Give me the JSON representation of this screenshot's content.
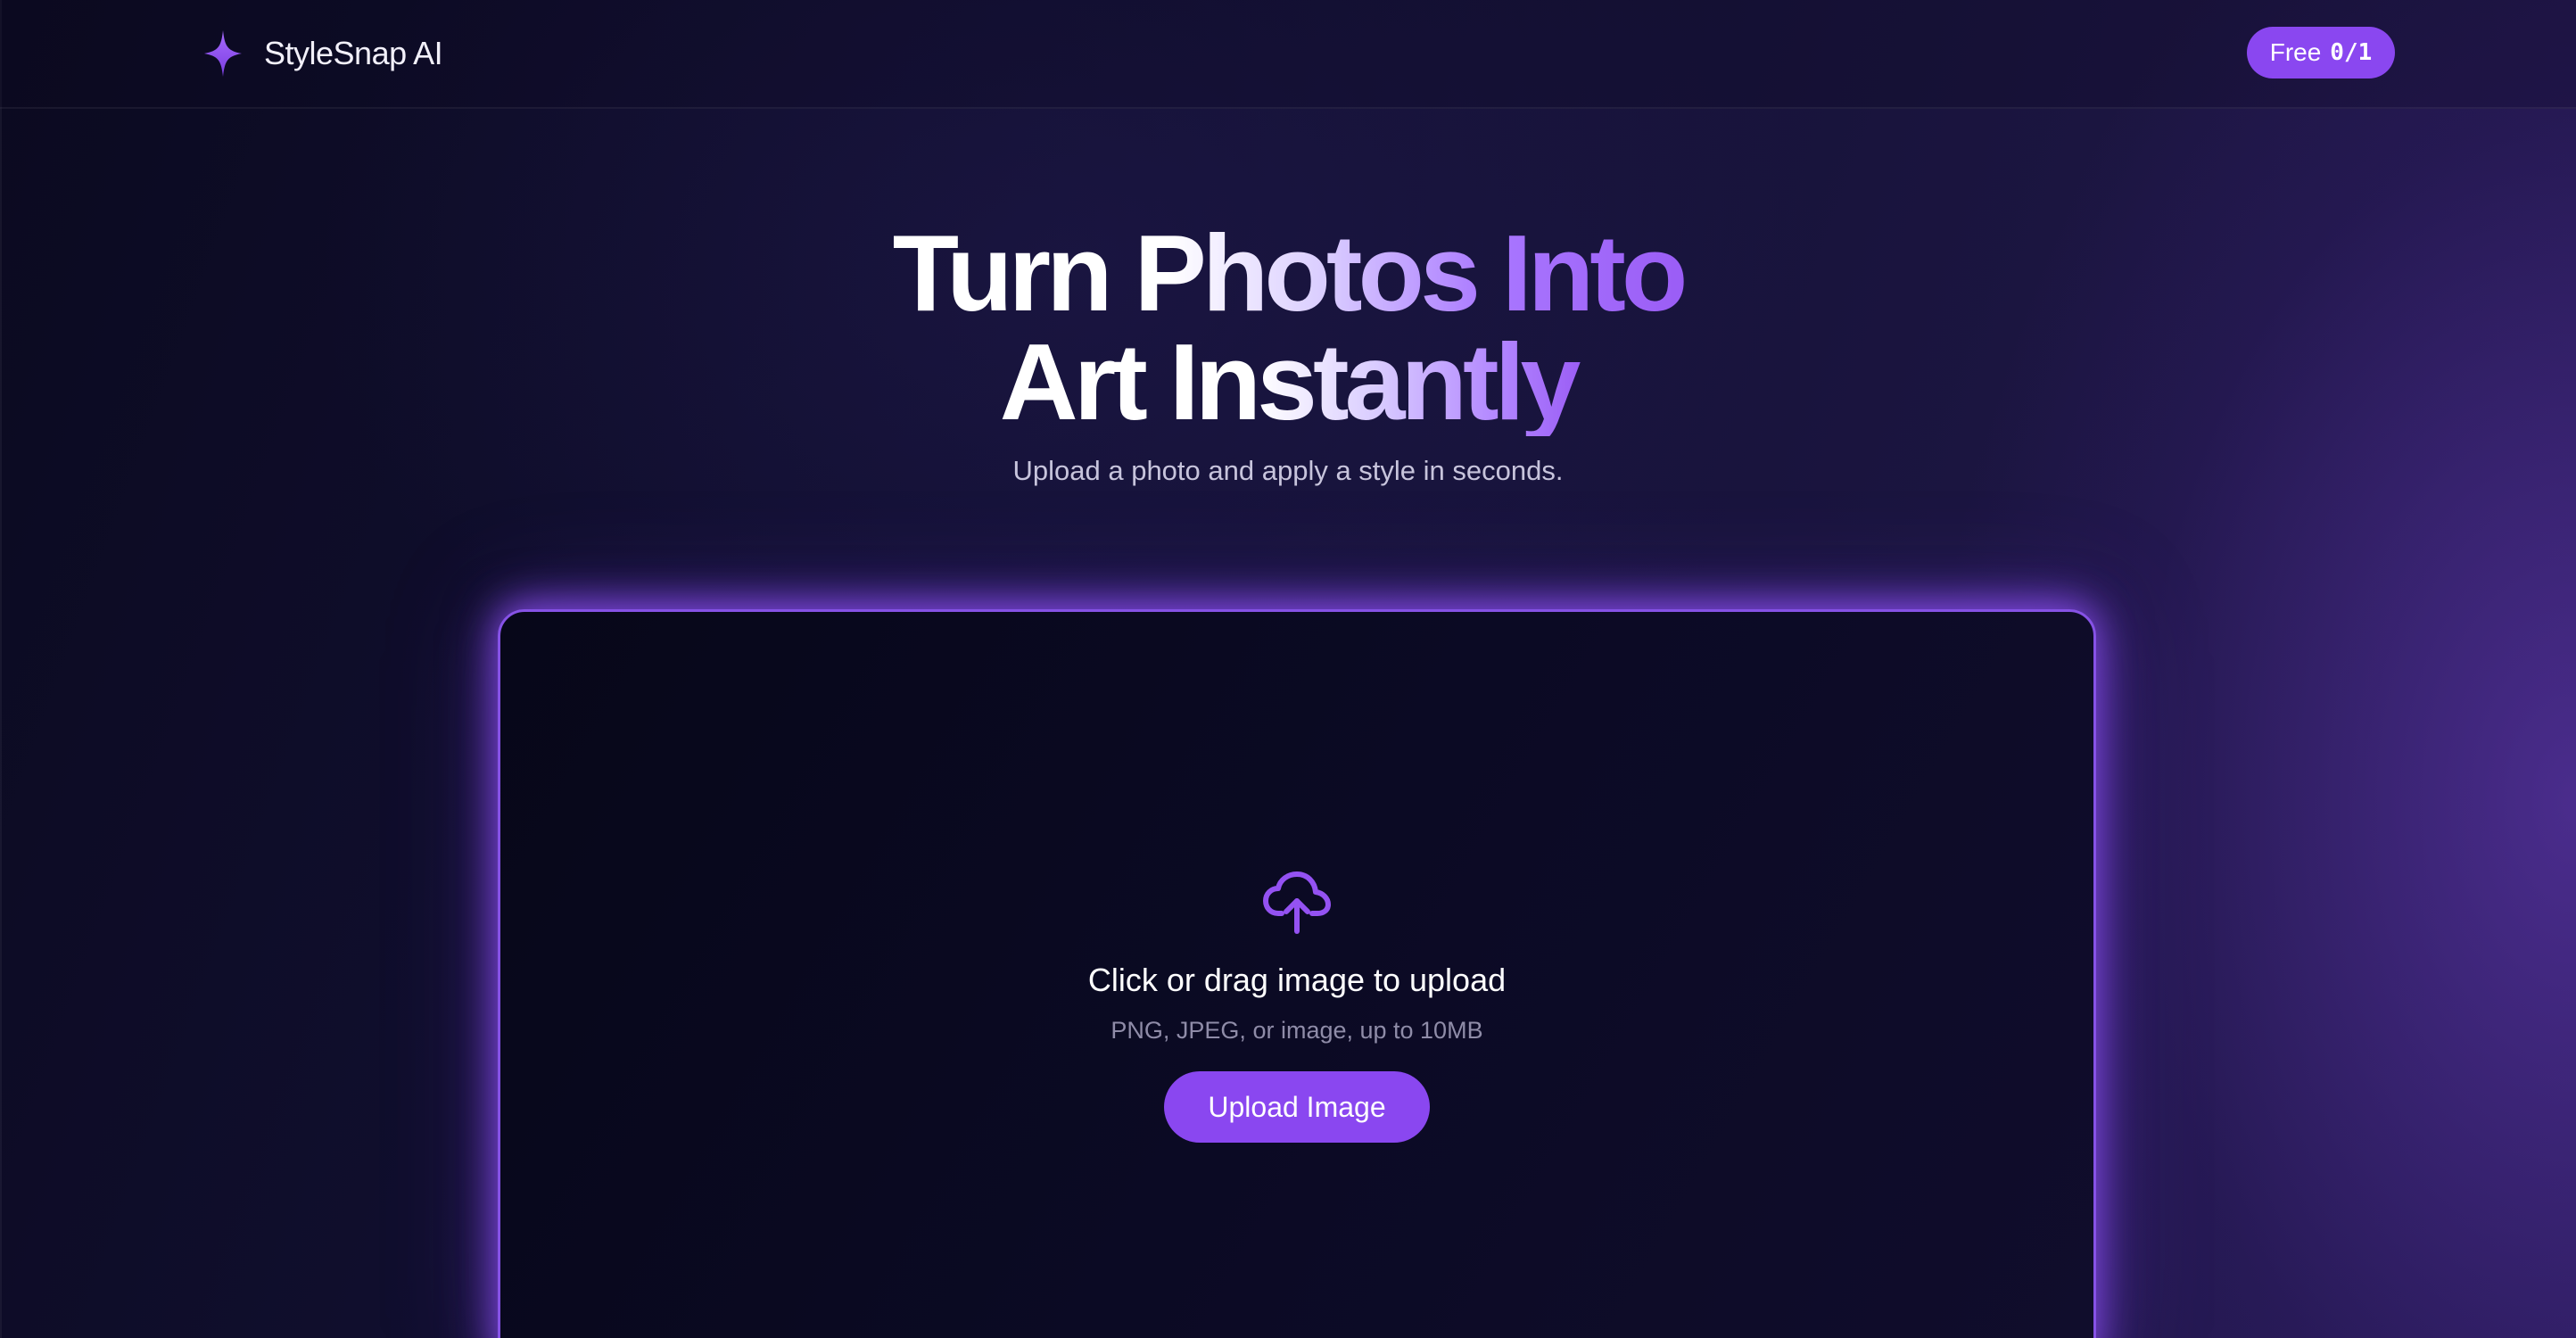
{
  "header": {
    "brand_name": "StyleSnap AI",
    "brand_icon": "sparkle-icon",
    "free_label": "Free",
    "free_count": "0/1"
  },
  "hero": {
    "title_line1": "Turn Photos Into",
    "title_line2": "Art Instantly",
    "subtitle": "Upload a photo and apply a style in seconds."
  },
  "upload": {
    "icon": "cloud-upload-icon",
    "title": "Click or drag image to upload",
    "hint": "PNG, JPEG, or image, up to 10MB",
    "button_label": "Upload Image"
  },
  "colors": {
    "accent": "#8a47f0",
    "background": "#0d0b24",
    "card_border": "#8652e6"
  }
}
